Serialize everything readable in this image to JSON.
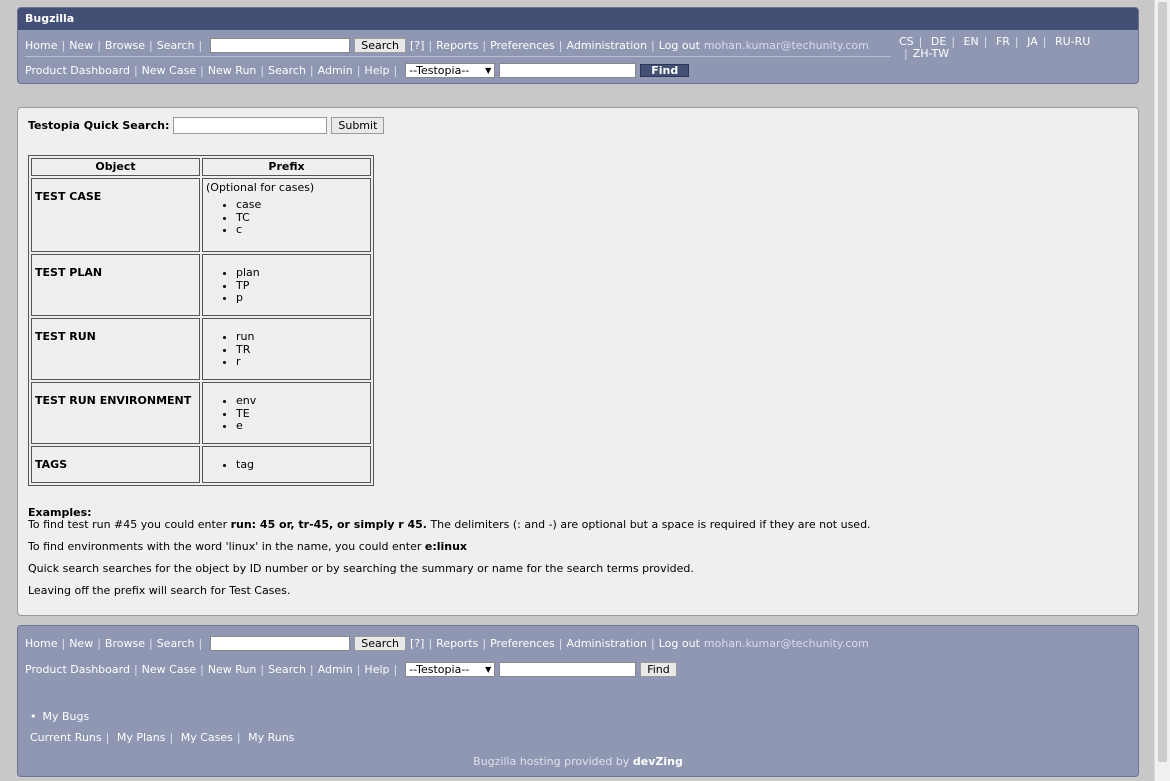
{
  "app": {
    "title": "Bugzilla"
  },
  "nav": {
    "home": "Home",
    "new": "New",
    "browse": "Browse",
    "search": "Search",
    "search_button": "Search",
    "help": "[?]",
    "reports": "Reports",
    "preferences": "Preferences",
    "administration": "Administration",
    "logout": "Log out",
    "user": "mohan.kumar@techunity.com"
  },
  "testopia_nav": {
    "product_dashboard": "Product Dashboard",
    "new_case": "New Case",
    "new_run": "New Run",
    "search": "Search",
    "admin": "Admin",
    "help": "Help",
    "select_value": "--Testopia--",
    "find_button": "Find"
  },
  "languages": [
    "CS",
    "DE",
    "EN",
    "FR",
    "JA",
    "RU-RU",
    "ZH-TW"
  ],
  "quick_search": {
    "label": "Testopia Quick Search:",
    "submit": "Submit"
  },
  "prefix_table": {
    "headers": [
      "Object",
      "Prefix"
    ],
    "rows": [
      {
        "object": "TEST CASE",
        "note": "(Optional for cases)",
        "prefixes": [
          "case",
          "TC",
          "c"
        ]
      },
      {
        "object": "TEST PLAN",
        "note": "",
        "prefixes": [
          "plan",
          "TP",
          "p"
        ]
      },
      {
        "object": "TEST RUN",
        "note": "",
        "prefixes": [
          "run",
          "TR",
          "r"
        ]
      },
      {
        "object": "TEST RUN ENVIRONMENT",
        "note": "",
        "prefixes": [
          "env",
          "TE",
          "e"
        ]
      },
      {
        "object": "TAGS",
        "note": "",
        "prefixes": [
          "tag"
        ]
      }
    ]
  },
  "examples": {
    "heading": "Examples:",
    "line1_prefix": "To find test run #45 you could enter ",
    "line1_bold": "run: 45 or, tr-45, or simply r 45.",
    "line1_suffix": " The delimiters (: and -) are optional but a space is required if they are not used.",
    "line2_prefix": "To find environments with the word 'linux' in the name, you could enter ",
    "line2_bold": "e:linux",
    "line3": "Quick search searches for the object by ID number or by searching the summary or name for the search terms provided.",
    "line4": "Leaving off the prefix will search for Test Cases."
  },
  "footer": {
    "my_bugs": "My Bugs",
    "current_runs": "Current Runs",
    "my_plans": "My Plans",
    "my_cases": "My Cases",
    "my_runs": "My Runs",
    "hosting_text": "Bugzilla hosting provided by ",
    "hosting_link": "devZing"
  }
}
